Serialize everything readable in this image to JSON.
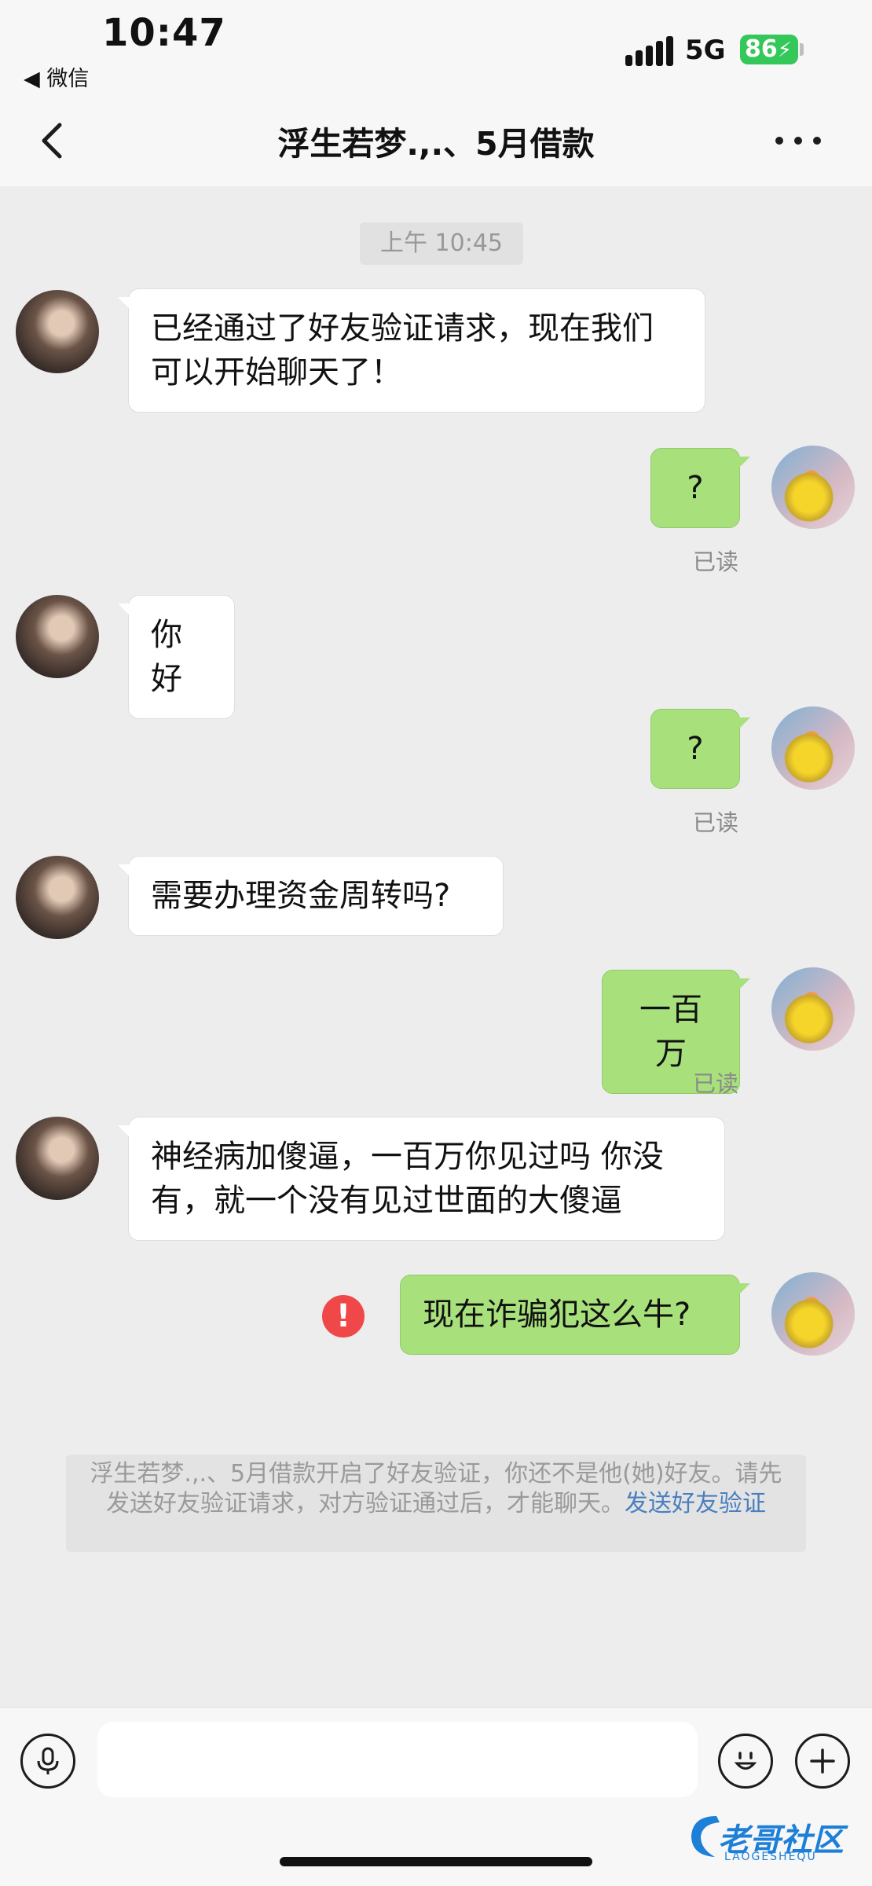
{
  "status_bar": {
    "time": "10:47",
    "back_app": "◀ 微信",
    "network": "5G",
    "battery": "86",
    "battery_color": "#34c759"
  },
  "nav": {
    "back_icon": "chevron-left-icon",
    "title": "浮生若梦.,.、5月借款",
    "more_icon": "more-dots-icon"
  },
  "chat": {
    "timestamp": "上午 10:45",
    "messages": [
      {
        "side": "in",
        "text": "已经通过了好友验证请求，现在我们可以开始聊天了！"
      },
      {
        "side": "out",
        "text": "?",
        "status": "已读"
      },
      {
        "side": "in",
        "text": "你好"
      },
      {
        "side": "out",
        "text": "?",
        "status": "已读"
      },
      {
        "side": "in",
        "text": "需要办理资金周转吗?"
      },
      {
        "side": "out",
        "text": "一百万",
        "status": "已读"
      },
      {
        "side": "in",
        "text": "神经病加傻逼，一百万你见过吗  你没有，就一个没有见过世面的大傻逼"
      },
      {
        "side": "out",
        "text": "现在诈骗犯这么牛?",
        "status": "failed"
      }
    ],
    "fail_mark": "!",
    "system_notice": {
      "text": "浮生若梦.,.、5月借款开启了好友验证，你还不是他(她)好友。请先发送好友验证请求，对方验证通过后，才能聊天。",
      "link": "发送好友验证"
    }
  },
  "input_bar": {
    "voice_icon": "microphone-icon",
    "emoji_icon": "emoji-icon",
    "plus_icon": "plus-icon",
    "placeholder": ""
  },
  "watermark": {
    "text": "老哥社区",
    "sub": "LAOGESHEQU"
  },
  "colors": {
    "bubble_out": "#a8e07c",
    "bubble_in": "#ffffff",
    "background": "#ededed",
    "fail": "#f04848",
    "link": "#4a7fc0"
  }
}
